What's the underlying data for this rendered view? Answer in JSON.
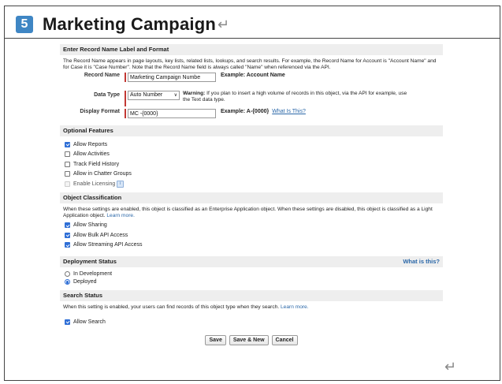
{
  "header": {
    "step_number": "5",
    "title": "Marketing Campaign",
    "return_mark": "↵"
  },
  "record_name": {
    "section_title": "Enter Record Name Label and Format",
    "description": "The Record Name appears in page layouts, key lists, related lists, lookups, and search results. For example, the Record Name for Account is \"Account Name\" and for Case it is \"Case Number\". Note that the Record Name field is always called \"Name\" when referenced via the API.",
    "name_label": "Record Name",
    "name_value": "Marketing Campaign Numbe",
    "name_example": "Example:  Account Name",
    "data_type_label": "Data Type",
    "data_type_value": "Auto Number",
    "warning_bold": "Warning:",
    "warning_text": " If you plan to insert a high volume of records in this object, via the API for example, use the Text data type.",
    "display_format_label": "Display Format",
    "display_format_value": "MC -{0000}",
    "format_example": "Example:  A-{0000}",
    "what_is_this": "What Is This?"
  },
  "optional_features": {
    "section_title": "Optional Features",
    "items": [
      {
        "label": "Allow Reports",
        "checked": true,
        "disabled": false
      },
      {
        "label": "Allow Activities",
        "checked": false,
        "disabled": false
      },
      {
        "label": "Track Field History",
        "checked": false,
        "disabled": false
      },
      {
        "label": "Allow in Chatter Groups",
        "checked": false,
        "disabled": false
      },
      {
        "label": "Enable Licensing",
        "checked": false,
        "disabled": true
      }
    ],
    "info_icon": "i"
  },
  "object_classification": {
    "section_title": "Object Classification",
    "description": "When these settings are enabled, this object is classified as an Enterprise Application object. When these settings are disabled, this object is classified as a Light Application object. ",
    "learn_more": "Learn more.",
    "items": [
      {
        "label": "Allow Sharing",
        "checked": true
      },
      {
        "label": "Allow Bulk API Access",
        "checked": true
      },
      {
        "label": "Allow Streaming API Access",
        "checked": true
      }
    ]
  },
  "deployment_status": {
    "section_title": "Deployment Status",
    "help_link": "What is this?",
    "options": [
      {
        "label": "In Development",
        "selected": false
      },
      {
        "label": "Deployed",
        "selected": true
      }
    ]
  },
  "search_status": {
    "section_title": "Search Status",
    "description": "When this setting is enabled, your users can find records of this object type when they search. ",
    "learn_more": "Learn more.",
    "allow_search_label": "Allow Search",
    "allow_search_checked": true
  },
  "buttons": {
    "save": "Save",
    "save_new": "Save & New",
    "cancel": "Cancel"
  },
  "colors": {
    "accent": "#3f86c4",
    "checkbox": "#2f6fd6",
    "required": "#c23934",
    "link": "#2a67a8"
  }
}
